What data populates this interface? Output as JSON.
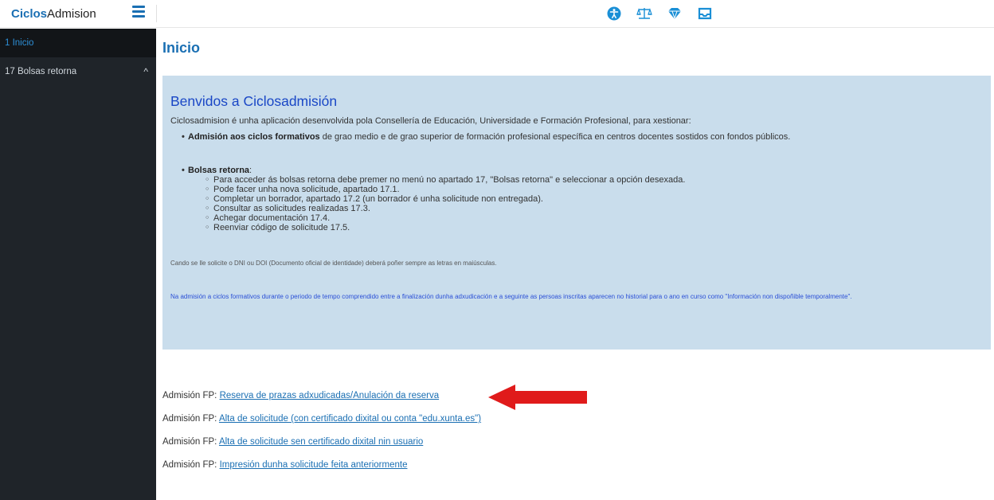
{
  "brand": {
    "part1": "Ciclos",
    "part2": "Admision"
  },
  "top_icons": [
    "accessibility-icon",
    "scales-icon",
    "gem-icon",
    "inbox-icon"
  ],
  "sidebar": {
    "items": [
      {
        "label": "1 Inicio",
        "active": true
      },
      {
        "label": "17 Bolsas retorna",
        "chevron": "^"
      }
    ]
  },
  "page": {
    "title": "Inicio"
  },
  "welcome": {
    "heading": "Benvidos a Ciclosadmisión",
    "intro": "Ciclosadmision é unha aplicación desenvolvida pola Consellería de Educación, Universidade e Formación Profesional, para xestionar:",
    "bullet1_bold": "Admisión aos ciclos formativos",
    "bullet1_rest": " de grao medio e de grao superior de formación profesional específica en centros docentes sostidos con fondos públicos.",
    "bullet2_bold": "Bolsas retorna",
    "bullet2_rest": ":",
    "sub_items": [
      "Para acceder ás bolsas retorna debe premer no menú no apartado 17, \"Bolsas retorna\" e seleccionar a opción desexada.",
      "Pode facer unha nova solicitude, apartado 17.1.",
      "Completar un borrador, apartado 17.2 (un borrador é unha solicitude non entregada).",
      "Consultar as solicitudes realizadas 17.3.",
      "Achegar documentación 17.4.",
      "Reenviar código de solicitude 17.5."
    ],
    "note1": "Cando se lle solicite o DNI ou DOI (Documento oficial de identidade) deberá poñer sempre as letras en maiúsculas.",
    "note2": "Na admisión a ciclos formativos durante o periodo de tempo comprendido entre a finalización dunha adxudicación e a seguinte as persoas inscritas aparecen no historial para o ano en curso  como \"Información non dispoñible temporalmente\"."
  },
  "links": [
    {
      "prefix": "Admisión FP: ",
      "text": "Reserva de prazas adxudicadas/Anulación da reserva"
    },
    {
      "prefix": "Admisión FP: ",
      "text": "Alta de solicitude (con certificado dixital ou conta \"edu.xunta.es\")"
    },
    {
      "prefix": "Admisión FP: ",
      "text": "Alta de solicitude sen certificado dixital nin usuario"
    },
    {
      "prefix": "Admisión FP: ",
      "text": "Impresión dunha solicitude feita anteriormente"
    }
  ],
  "colors": {
    "accent": "#1a6fb3",
    "sidebar_bg": "#1f2429",
    "panel_bg": "#c9ddec",
    "arrow": "#e01b1b"
  }
}
